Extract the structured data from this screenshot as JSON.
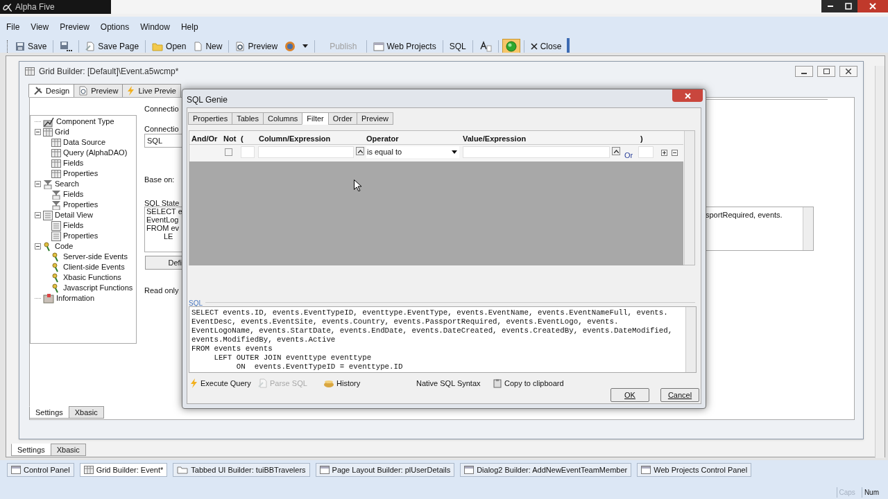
{
  "app": {
    "title": "Alpha Five",
    "menu": [
      "File",
      "View",
      "Preview",
      "Options",
      "Window",
      "Help"
    ],
    "toolbar": [
      {
        "kind": "button",
        "label": "Save",
        "disabled": false,
        "pressed": false
      },
      {
        "kind": "icon",
        "disabled": false,
        "pressed": false
      },
      {
        "kind": "button",
        "label": "Save Page",
        "disabled": false,
        "pressed": false
      },
      {
        "kind": "button",
        "label": "Open",
        "disabled": false,
        "pressed": false
      },
      {
        "kind": "button",
        "label": "New",
        "disabled": false,
        "pressed": false
      },
      {
        "kind": "button",
        "label": "Preview",
        "disabled": false,
        "pressed": false
      },
      {
        "kind": "menu",
        "disabled": false,
        "pressed": false
      },
      {
        "kind": "button",
        "label": "Publish",
        "disabled": true,
        "pressed": false
      },
      {
        "kind": "button",
        "label": "Web Projects",
        "disabled": false,
        "pressed": false
      },
      {
        "kind": "button",
        "label": "SQL",
        "disabled": false,
        "pressed": false
      },
      {
        "kind": "icon",
        "disabled": false,
        "pressed": false
      },
      {
        "kind": "icon",
        "disabled": false,
        "pressed": true
      },
      {
        "kind": "button",
        "label": "Close",
        "disabled": false,
        "pressed": false
      }
    ]
  },
  "grid_builder": {
    "title": "Grid Builder: [Default]\\Event.a5wcmp*",
    "tabs": [
      {
        "label": "Design",
        "selected": true
      },
      {
        "label": "Preview",
        "selected": false
      },
      {
        "label": "Live Previe",
        "selected": false
      }
    ],
    "tree": [
      {
        "label": "Component Type"
      },
      {
        "label": "Grid",
        "expanded": true,
        "children": [
          {
            "label": "Data Source"
          },
          {
            "label": "Query (AlphaDAO)"
          },
          {
            "label": "Fields"
          },
          {
            "label": "Properties"
          }
        ]
      },
      {
        "label": "Search",
        "expanded": true,
        "children": [
          {
            "label": "Fields"
          },
          {
            "label": "Properties"
          }
        ]
      },
      {
        "label": "Detail View",
        "expanded": true,
        "children": [
          {
            "label": "Fields"
          },
          {
            "label": "Properties"
          }
        ]
      },
      {
        "label": "Code",
        "expanded": true,
        "children": [
          {
            "label": "Server-side Events"
          },
          {
            "label": "Client-side Events"
          },
          {
            "label": "Xbasic Functions"
          },
          {
            "label": "Javascript Functions"
          }
        ]
      },
      {
        "label": "Information"
      }
    ],
    "form": {
      "connection_label_1": "Connectio",
      "connection_label_2": "Connectio",
      "connection_value": "SQL",
      "base_on_label": "Base on:",
      "sql_statement_label": "SQL State",
      "sql_statement_lines": [
        "SELECT e",
        "EventLog",
        "FROM ev",
        "LE"
      ],
      "define_button": "Defi",
      "read_only_label": "Read only",
      "right_text": "sportRequired, events."
    },
    "bottom_tabs": [
      {
        "label": "Settings",
        "selected": true
      },
      {
        "label": "Xbasic",
        "selected": false
      }
    ]
  },
  "outer_tabs": [
    {
      "label": "Settings",
      "selected": true
    },
    {
      "label": "Xbasic",
      "selected": false
    }
  ],
  "sql_genie": {
    "title": "SQL Genie",
    "tabs": [
      {
        "label": "Properties",
        "selected": false
      },
      {
        "label": "Tables",
        "selected": false
      },
      {
        "label": "Columns",
        "selected": false
      },
      {
        "label": "Filter",
        "selected": true
      },
      {
        "label": "Order",
        "selected": false
      },
      {
        "label": "Preview",
        "selected": false
      }
    ],
    "filter_columns": [
      "And/Or",
      "Not",
      "(",
      "Column/Expression",
      "Operator",
      "Value/Expression",
      ")"
    ],
    "filter_row": {
      "not_checked": false,
      "operator": "is equal to",
      "connector": "Or"
    },
    "sql_label": "SQL",
    "sql_lines": [
      "SELECT events.ID, events.EventTypeID, eventtype.EventType, events.EventName, events.EventNameFull, events.",
      "EventDesc, events.EventSite, events.Country, events.PassportRequired, events.EventLogo, events.",
      "EventLogoName, events.StartDate, events.EndDate, events.DateCreated, events.CreatedBy, events.DateModified,",
      "events.ModifiedBy, events.Active",
      "FROM events events",
      "     LEFT OUTER JOIN eventtype eventtype",
      "          ON  events.EventTypeID = eventtype.ID"
    ],
    "actions": [
      {
        "label": "Execute Query",
        "disabled": false
      },
      {
        "label": "Parse SQL",
        "disabled": true
      },
      {
        "label": "History",
        "disabled": false
      },
      {
        "label": "Native SQL Syntax",
        "disabled": false
      },
      {
        "label": "Copy to clipboard",
        "disabled": false
      }
    ],
    "buttons": [
      "OK",
      "Cancel"
    ]
  },
  "taskbar": [
    {
      "label": "Control Panel",
      "selected": false
    },
    {
      "label": "Grid Builder: Event*",
      "selected": true
    },
    {
      "label": "Tabbed UI Builder: tuiBBTravelers",
      "selected": false
    },
    {
      "label": "Page Layout Builder: plUserDetails",
      "selected": false
    },
    {
      "label": "Dialog2 Builder: AddNewEventTeamMember",
      "selected": false
    },
    {
      "label": "Web Projects Control Panel",
      "selected": false
    }
  ],
  "status": [
    {
      "label": "Caps",
      "disabled": true
    },
    {
      "label": "Num",
      "disabled": false
    }
  ]
}
